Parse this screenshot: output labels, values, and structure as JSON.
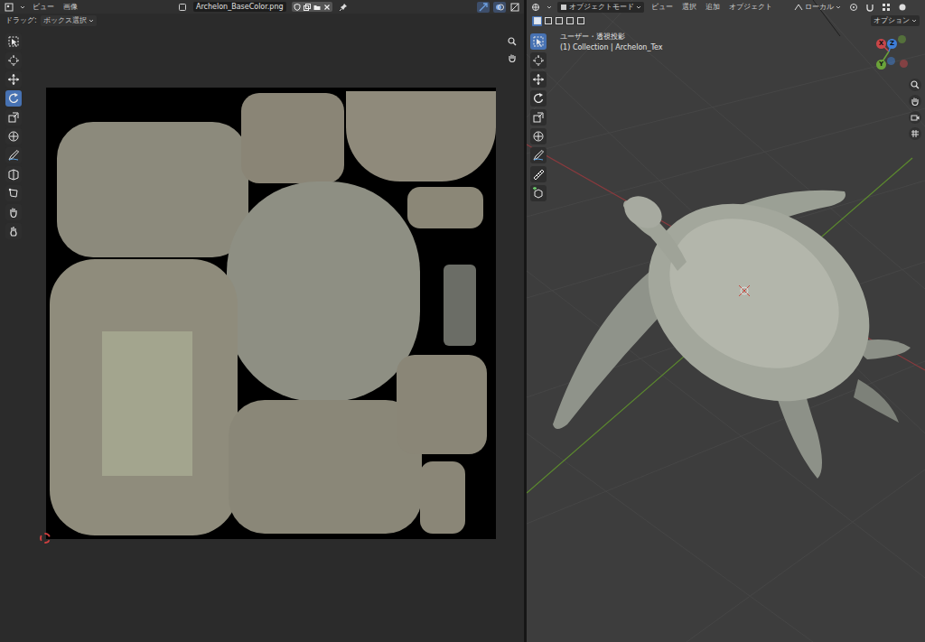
{
  "image_editor": {
    "menus": [
      "ビュー",
      "画像"
    ],
    "image_name": "Archelon_BaseColor.png",
    "drag_label": "ドラッグ:",
    "drag_mode": "ボックス選択",
    "tools": [
      {
        "kind": "select",
        "selected": false
      },
      {
        "kind": "cursor",
        "selected": false
      },
      {
        "kind": "move",
        "selected": false
      },
      {
        "kind": "rotate",
        "selected": true
      },
      {
        "kind": "scale",
        "selected": false
      },
      {
        "kind": "transform",
        "selected": false
      },
      {
        "kind": "annotate",
        "selected": false
      },
      {
        "kind": "rip",
        "selected": false
      },
      {
        "kind": "polygon",
        "selected": false
      },
      {
        "kind": "grab",
        "selected": false
      },
      {
        "kind": "pinch",
        "selected": false
      }
    ]
  },
  "viewport": {
    "mode": "オブジェクトモード",
    "menus": [
      "ビュー",
      "選択",
      "追加",
      "オブジェクト"
    ],
    "transform_orientation": "ローカル",
    "options": "オプション",
    "view_name": "ユーザー・透視投影",
    "collection_path": "(1) Collection | Archelon_Tex",
    "axes": [
      {
        "label": "X",
        "color": "#c8464a"
      },
      {
        "label": "Y",
        "color": "#6ba33a"
      },
      {
        "label": "Z",
        "color": "#3f7fd6"
      }
    ],
    "tools": [
      {
        "kind": "select",
        "selected": true
      },
      {
        "kind": "cursor",
        "selected": false
      },
      {
        "kind": "move",
        "selected": false
      },
      {
        "kind": "rotate",
        "selected": false
      },
      {
        "kind": "scale",
        "selected": false
      },
      {
        "kind": "transform",
        "selected": false
      },
      {
        "kind": "annotate",
        "selected": false
      },
      {
        "kind": "measure",
        "selected": false
      },
      {
        "kind": "add",
        "selected": false
      }
    ]
  }
}
